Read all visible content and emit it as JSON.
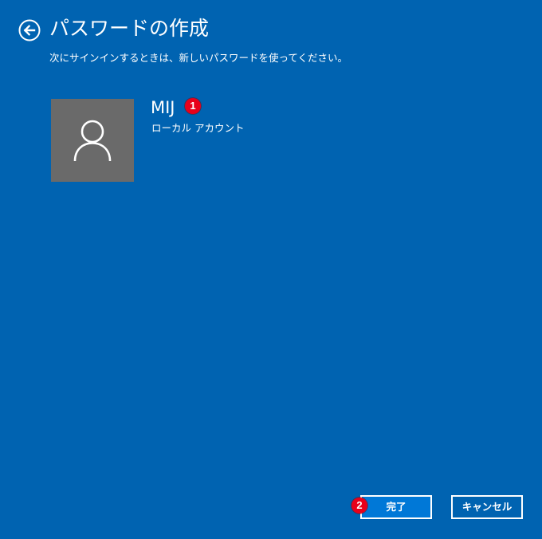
{
  "header": {
    "title": "パスワードの作成",
    "back_icon": "back-arrow-icon"
  },
  "subtitle": "次にサインインするときは、新しいパスワードを使ってください。",
  "account": {
    "name": "MIJ",
    "type": "ローカル アカウント",
    "avatar_icon": "user-silhouette-icon"
  },
  "markers": {
    "first": "1",
    "second": "2"
  },
  "buttons": {
    "finish_label": "完了",
    "cancel_label": "キャンセル"
  },
  "colors": {
    "background": "#0063b1",
    "primary_button": "#0078d7",
    "avatar_bg": "#6a6a6a",
    "marker": "#e8001a",
    "text": "#ffffff"
  }
}
